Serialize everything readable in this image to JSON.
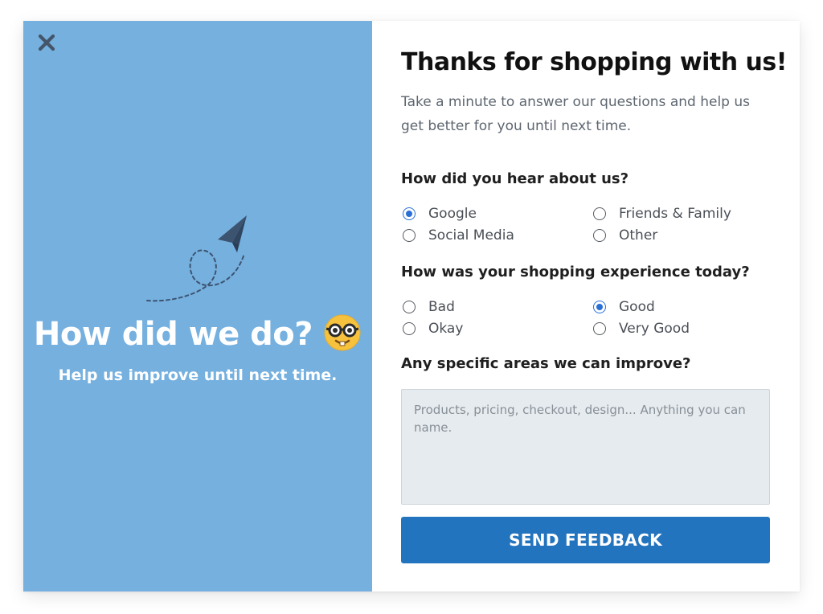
{
  "left_panel": {
    "close_icon": "close-icon",
    "illustration_icon": "paper-plane-icon",
    "hero_title": "How did we do?",
    "emoji": "nerd-face-emoji",
    "hero_subtitle": "Help us improve until next time.",
    "background_color": "#75b0df"
  },
  "form": {
    "title": "Thanks for shopping with us!",
    "description": "Take a minute to answer our questions and help us get better for you until next time.",
    "questions": [
      {
        "label": "How did you hear about us?",
        "options": [
          {
            "label": "Google",
            "selected": true
          },
          {
            "label": "Friends & Family",
            "selected": false
          },
          {
            "label": "Social Media",
            "selected": false
          },
          {
            "label": "Other",
            "selected": false
          }
        ]
      },
      {
        "label": "How was your shopping experience today?",
        "options": [
          {
            "label": "Bad",
            "selected": false
          },
          {
            "label": "Good",
            "selected": true
          },
          {
            "label": "Okay",
            "selected": false
          },
          {
            "label": "Very Good",
            "selected": false
          }
        ]
      },
      {
        "label": "Any specific areas we can improve?",
        "placeholder": "Products, pricing, checkout, design... Anything you can name.",
        "value": ""
      }
    ],
    "submit_label": "SEND FEEDBACK",
    "accent_color": "#2374be",
    "radio_selected_color": "#2a6fd6"
  }
}
